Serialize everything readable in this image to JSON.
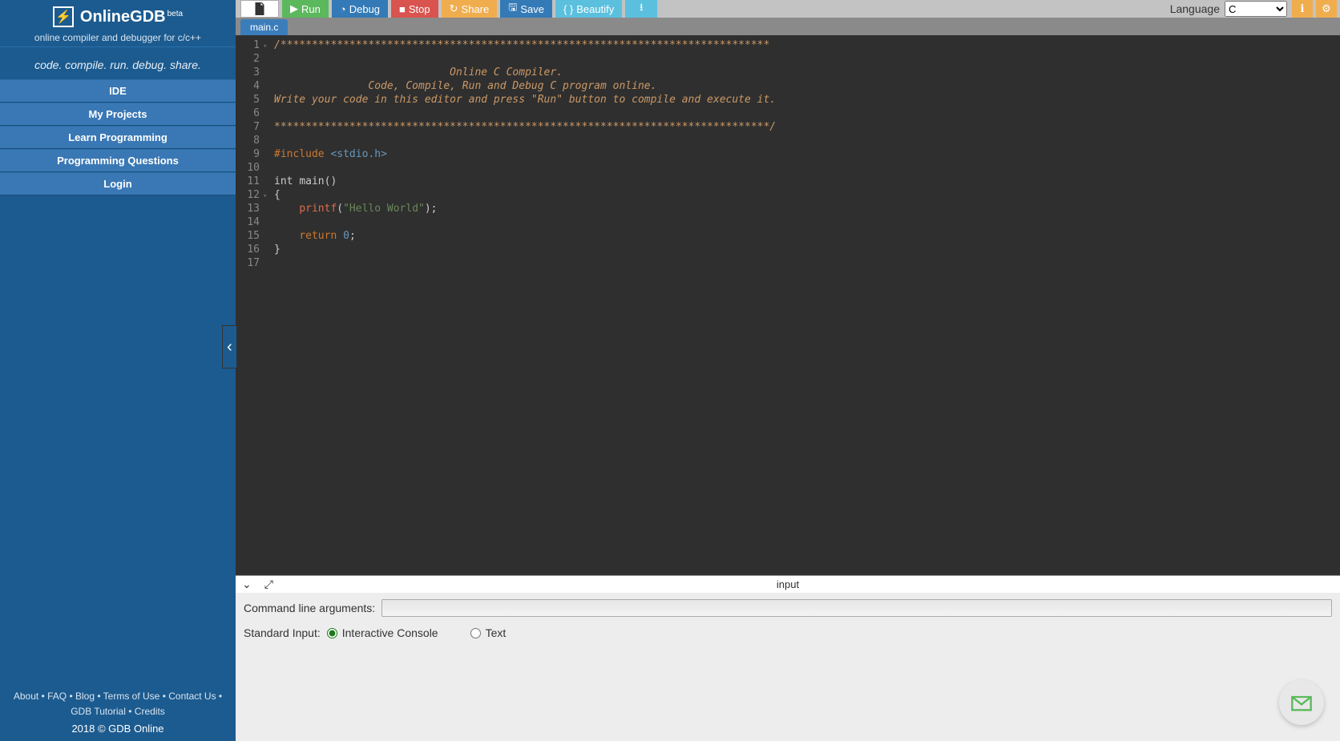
{
  "sidebar": {
    "title": "OnlineGDB",
    "beta": "beta",
    "subtitle": "online compiler and debugger for c/c++",
    "slogan": "code. compile. run. debug. share.",
    "nav": [
      "IDE",
      "My Projects",
      "Learn Programming",
      "Programming Questions",
      "Login"
    ],
    "footer_links": [
      "About",
      "FAQ",
      "Blog",
      "Terms of Use",
      "Contact Us",
      "GDB Tutorial",
      "Credits"
    ],
    "copyright": "2018 © GDB Online"
  },
  "toolbar": {
    "run": "Run",
    "debug": "Debug",
    "stop": "Stop",
    "share": "Share",
    "save": "Save",
    "beautify": "Beautify",
    "language_label": "Language",
    "language_selected": "C"
  },
  "tabs": [
    "main.c"
  ],
  "code": {
    "lines": [
      {
        "n": "1",
        "fold": "-",
        "cls": "c-comment",
        "t": "/******************************************************************************"
      },
      {
        "n": "2",
        "cls": "c-comment",
        "t": ""
      },
      {
        "n": "3",
        "cls": "c-comment",
        "t": "                            Online C Compiler."
      },
      {
        "n": "4",
        "cls": "c-comment",
        "t": "               Code, Compile, Run and Debug C program online."
      },
      {
        "n": "5",
        "cls": "c-comment",
        "t": "Write your code in this editor and press \"Run\" button to compile and execute it."
      },
      {
        "n": "6",
        "cls": "c-comment",
        "t": ""
      },
      {
        "n": "7",
        "cls": "c-comment",
        "t": "*******************************************************************************/"
      },
      {
        "n": "8",
        "t": ""
      },
      {
        "n": "9",
        "html": "<span class='c-keyword'>#include</span> <span class='c-include'>&lt;stdio.h&gt;</span>"
      },
      {
        "n": "10",
        "t": ""
      },
      {
        "n": "11",
        "html": "<span>int</span> <span>main</span>()"
      },
      {
        "n": "12",
        "fold": "-",
        "t": "{"
      },
      {
        "n": "13",
        "html": "    <span class='c-func'>printf</span>(<span class='c-string'>\"Hello World\"</span>);"
      },
      {
        "n": "14",
        "t": ""
      },
      {
        "n": "15",
        "html": "    <span class='c-keyword'>return</span> <span class='c-num'>0</span>;"
      },
      {
        "n": "16",
        "t": "}"
      },
      {
        "n": "17",
        "t": ""
      }
    ]
  },
  "panel": {
    "title": "input",
    "cmd_label": "Command line arguments:",
    "cmd_value": "",
    "stdin_label": "Standard Input:",
    "opt_interactive": "Interactive Console",
    "opt_text": "Text"
  }
}
